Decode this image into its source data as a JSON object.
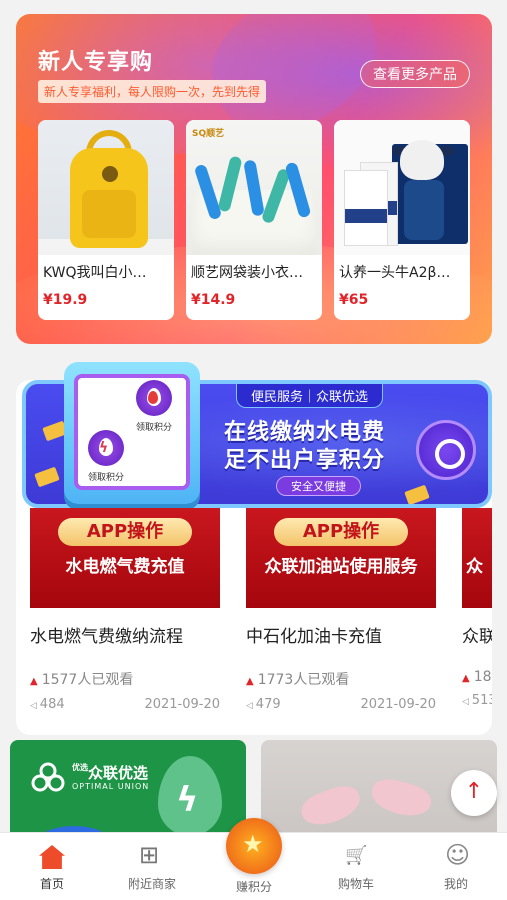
{
  "promo": {
    "title": "新人专享购",
    "subtitle": "新人专享福利，每人限购一次，先到先得",
    "more_label": "查看更多产品",
    "products": [
      {
        "name": "KWQ我叫白小…",
        "price": "¥19.9"
      },
      {
        "name": "顺艺网袋装小衣…",
        "price": "¥14.9"
      },
      {
        "name": "认养一头牛A2β…",
        "price": "¥65"
      }
    ],
    "product2_brand": "SQ顺艺"
  },
  "banner": {
    "tag": "便民服务｜众联优选",
    "line1": "在线缴纳水电费",
    "line2": "足不出户享积分",
    "pill": "安全又便捷",
    "button1_label": "领取积分",
    "button2_label": "领取积分"
  },
  "videos": [
    {
      "badge": "APP操作",
      "subtitle": "水电燃气费充值",
      "title": "水电燃气费缴纳流程",
      "views": "1577人已观看",
      "count": "484",
      "date": "2021-09-20"
    },
    {
      "badge": "APP操作",
      "subtitle": "众联加油站使用服务",
      "title": "中石化加油卡充值",
      "views": "1773人已观看",
      "count": "479",
      "date": "2021-09-20"
    },
    {
      "badge": "",
      "subtitle": "众",
      "title": "众联",
      "views": "18",
      "count": "513",
      "date": ""
    }
  ],
  "green_card": {
    "brand_small": "优选",
    "brand": "众联优选",
    "brand_en": "OPTIMAL UNION"
  },
  "tabs": [
    {
      "label": "首页",
      "icon": "home-icon"
    },
    {
      "label": "附近商家",
      "icon": "grid-icon"
    },
    {
      "label": "赚积分",
      "icon": "star-coin-icon"
    },
    {
      "label": "购物车",
      "icon": "cart-icon"
    },
    {
      "label": "我的",
      "icon": "user-icon"
    }
  ],
  "colors": {
    "accent": "#e0252a",
    "promo_orange": "#ff5a2e",
    "banner_blue": "#3e3ad6",
    "green": "#1e9446"
  },
  "scroll_top_symbol": "↑"
}
